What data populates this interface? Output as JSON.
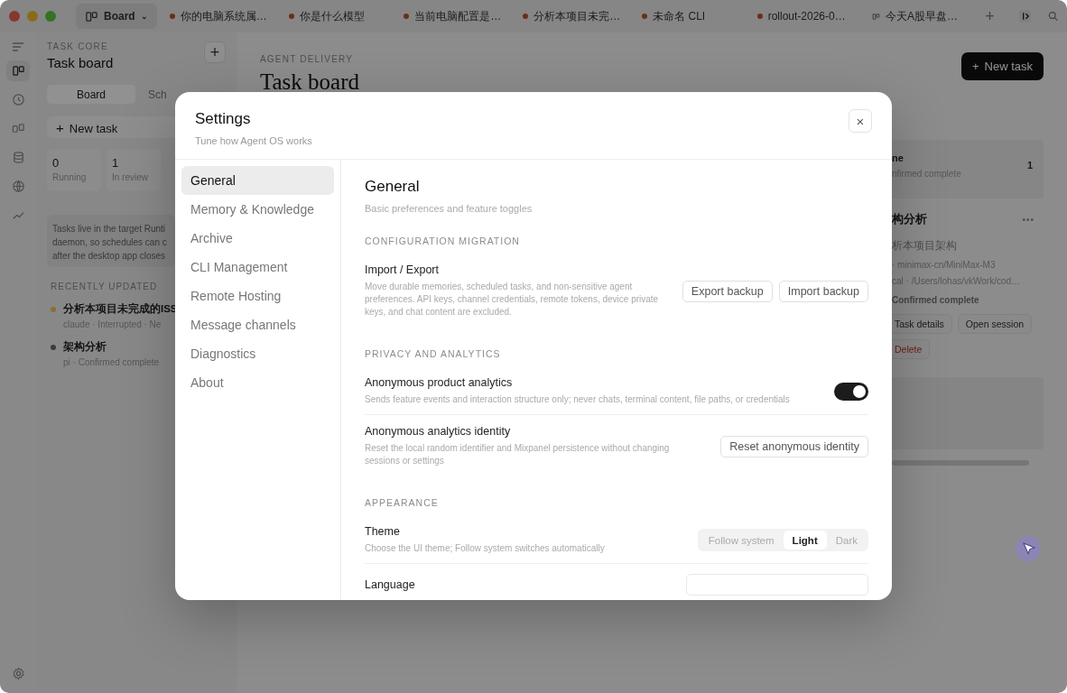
{
  "titlebar": {
    "tabs": [
      {
        "kind": "board",
        "label": "Board",
        "caret": "⌄",
        "selected": true
      },
      {
        "kind": "dot",
        "label": "你的电脑系统属…",
        "selected": false
      },
      {
        "kind": "dot",
        "label": "你是什么模型",
        "selected": false
      },
      {
        "kind": "dot",
        "label": "当前电脑配置是…",
        "selected": false
      },
      {
        "kind": "dot",
        "label": "分析本项目未完…",
        "selected": false
      },
      {
        "kind": "dot",
        "label": "未命名 CLI",
        "selected": false
      },
      {
        "kind": "dot",
        "label": "rollout-2026-0…",
        "selected": false
      },
      {
        "kind": "board",
        "label": "今天A股早盘…",
        "selected": false
      }
    ],
    "add": "+"
  },
  "rail": {
    "items": [
      {
        "kind": "board",
        "selected": true
      },
      {
        "kind": "clock",
        "selected": false
      },
      {
        "kind": "split",
        "selected": false
      },
      {
        "kind": "database",
        "selected": false
      },
      {
        "kind": "globe",
        "selected": false
      },
      {
        "kind": "chart",
        "selected": false
      }
    ]
  },
  "sidebar": {
    "eyebrow": "TASK CORE",
    "title": "Task board",
    "add": "+",
    "segments": [
      {
        "label": "Board",
        "selected": true
      },
      {
        "label": "Sch",
        "selected": false
      }
    ],
    "new_task": {
      "icon": "+",
      "label": "New task"
    },
    "stats": [
      {
        "value": "0",
        "label": "Running"
      },
      {
        "value": "1",
        "label": "In review"
      }
    ],
    "notice": [
      "Tasks live in the target Runti",
      "daemon, so schedules can c",
      "after the desktop app closes"
    ],
    "recent_heading": "RECENTLY UPDATED",
    "recent": [
      {
        "title": "分析本项目未完成的ISS",
        "meta": "claude · Interrupted · Ne",
        "color": "#8a7030"
      },
      {
        "title": "架构分析",
        "meta": "pi · Confirmed complete",
        "color": "#3c3c3c"
      }
    ]
  },
  "main": {
    "eyebrow": "AGENT DELIVERY",
    "title": "Task board",
    "new_task": {
      "icon": "+",
      "label": "New task"
    },
    "group": {
      "title": "ne",
      "subtitle": "nfirmed complete",
      "count": "1"
    },
    "task": {
      "title": "构分析",
      "menu": "•••",
      "prompt": "析本项目架构",
      "meta": [
        "· minimax-cn/MiniMax-M3",
        "cal · /Users/lohas/vkWork/cod…"
      ],
      "status": "Confirmed complete",
      "actions": [
        {
          "label": "Task details",
          "kind": "default"
        },
        {
          "label": "Open session",
          "kind": "default"
        },
        {
          "label": "Delete",
          "kind": "danger"
        }
      ]
    }
  },
  "settings": {
    "title": "Settings",
    "subtitle": "Tune how Agent OS works",
    "close": "×",
    "nav": [
      {
        "label": "General",
        "selected": true
      },
      {
        "label": "Memory & Knowledge",
        "selected": false
      },
      {
        "label": "Archive",
        "selected": false
      },
      {
        "label": "CLI Management",
        "selected": false
      },
      {
        "label": "Remote Hosting",
        "selected": false
      },
      {
        "label": "Message channels",
        "selected": false
      },
      {
        "label": "Diagnostics",
        "selected": false
      },
      {
        "label": "About",
        "selected": false
      }
    ],
    "panel": {
      "title": "General",
      "subtitle": "Basic preferences and feature toggles",
      "sections": [
        {
          "heading": "CONFIGURATION MIGRATION",
          "rows": [
            {
              "kind": "buttons",
              "label": "Import / Export",
              "description": "Move durable memories, scheduled tasks, and non-sensitive agent preferences. API keys, channel credentials, remote tokens, device private keys, and chat content are excluded.",
              "buttons": [
                "Export backup",
                "Import backup"
              ]
            }
          ]
        },
        {
          "heading": "PRIVACY AND ANALYTICS",
          "rows": [
            {
              "kind": "toggle",
              "label": "Anonymous product analytics",
              "description": "Sends feature events and interaction structure only; never chats, terminal content, file paths, or credentials",
              "on": true
            },
            {
              "kind": "buttons",
              "label": "Anonymous analytics identity",
              "description": "Reset the local random identifier and Mixpanel persistence without changing sessions or settings",
              "buttons": [
                "Reset anonymous identity"
              ]
            }
          ]
        },
        {
          "heading": "APPEARANCE",
          "rows": [
            {
              "kind": "segmented",
              "label": "Theme",
              "description": "Choose the UI theme; Follow system switches automatically",
              "options": [
                {
                  "label": "Follow system",
                  "selected": false
                },
                {
                  "label": "Light",
                  "selected": true
                },
                {
                  "label": "Dark",
                  "selected": false
                }
              ]
            },
            {
              "kind": "select",
              "label": "Language"
            }
          ]
        }
      ]
    }
  }
}
